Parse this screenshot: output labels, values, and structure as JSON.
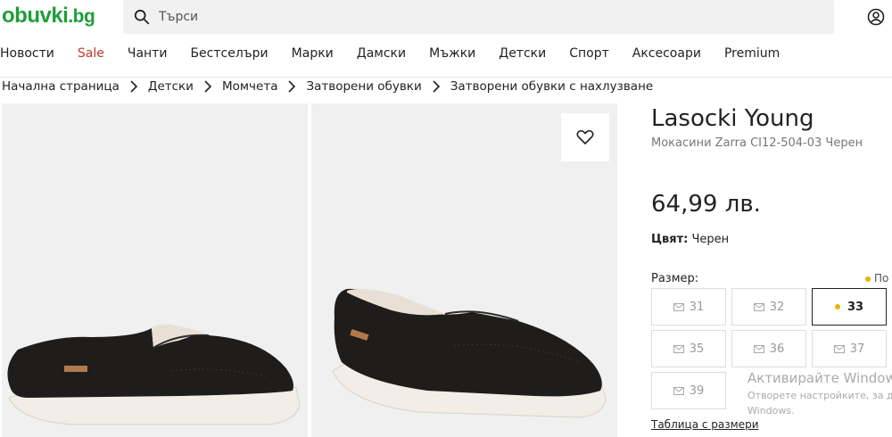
{
  "header": {
    "logo_main": "obuvki",
    "logo_tld": ".bg",
    "search_placeholder": "Търси",
    "colors": {
      "brand_green": "#1f9e3a",
      "sale_red": "#c0392b",
      "availability_dot": "#e8b400"
    },
    "icons": {
      "search": "search-icon",
      "account": "user-account-icon"
    }
  },
  "nav": {
    "items": [
      "Новости",
      "Sale",
      "Чанти",
      "Бестселъри",
      "Марки",
      "Дамски",
      "Мъжки",
      "Детски",
      "Спорт",
      "Аксесоари",
      "Premium"
    ]
  },
  "breadcrumb": {
    "items": [
      "Начална страница",
      "Детски",
      "Момчета",
      "Затворени обувки",
      "Затворени обувки с нахлузване"
    ]
  },
  "product": {
    "brand": "Lasocki Young",
    "model": "Мокасини Zarra CI12-504-03 Черен",
    "price": "64,99 лв.",
    "color_label": "Цвят:",
    "color_value": "Черен",
    "size_label": "Размер:",
    "availability_text": "По",
    "sizes": [
      {
        "label": "31",
        "state": "unavailable"
      },
      {
        "label": "32",
        "state": "unavailable"
      },
      {
        "label": "33",
        "state": "selected"
      },
      {
        "label": "35",
        "state": "unavailable"
      },
      {
        "label": "36",
        "state": "unavailable"
      },
      {
        "label": "37",
        "state": "unavailable"
      },
      {
        "label": "39",
        "state": "unavailable"
      }
    ],
    "size_table_link": "Таблица с размери"
  },
  "windows_watermark": {
    "title": "Активирайте Windows",
    "line1": "Отворете настройките, за да",
    "line2": "Windows."
  }
}
